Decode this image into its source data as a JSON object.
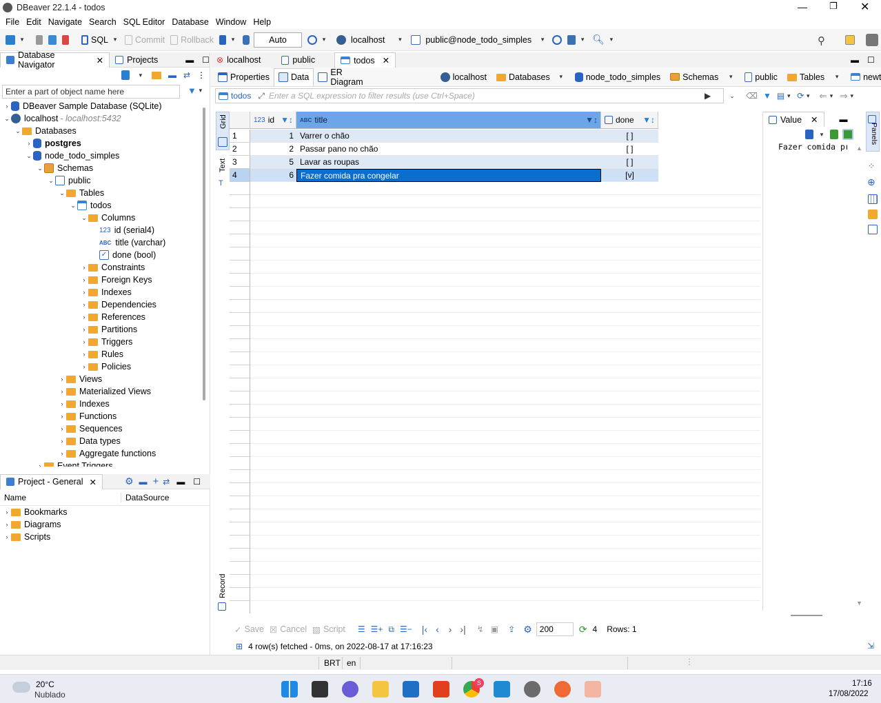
{
  "window": {
    "title": "DBeaver 22.1.4 - todos"
  },
  "menu": [
    "File",
    "Edit",
    "Navigate",
    "Search",
    "SQL Editor",
    "Database",
    "Window",
    "Help"
  ],
  "toolbar": {
    "sql": "SQL",
    "commit": "Commit",
    "rollback": "Rollback",
    "auto": "Auto",
    "connection": "localhost",
    "schema": "public@node_todo_simples"
  },
  "navigator": {
    "tabs": [
      "Database Navigator",
      "Projects"
    ],
    "filter_placeholder": "Enter a part of object name here",
    "tree": [
      {
        "label": "DBeaver Sample Database (SQLite)",
        "depth": 0,
        "caret": "›",
        "icon": "db-icon"
      },
      {
        "label": "localhost",
        "sub": " - localhost:5432",
        "depth": 0,
        "caret": "⌄",
        "icon": "server-icon"
      },
      {
        "label": "Databases",
        "depth": 1,
        "caret": "⌄",
        "icon": "folder-icon"
      },
      {
        "label": "postgres",
        "depth": 2,
        "caret": "›",
        "icon": "db-icon",
        "bold": true
      },
      {
        "label": "node_todo_simples",
        "depth": 2,
        "caret": "⌄",
        "icon": "db-icon"
      },
      {
        "label": "Schemas",
        "depth": 3,
        "caret": "⌄",
        "icon": "schema-folder-icon"
      },
      {
        "label": "public",
        "depth": 4,
        "caret": "⌄",
        "icon": "schema-icon"
      },
      {
        "label": "Tables",
        "depth": 5,
        "caret": "⌄",
        "icon": "tables-folder-icon"
      },
      {
        "label": "todos",
        "depth": 6,
        "caret": "⌄",
        "icon": "table-icon"
      },
      {
        "label": "Columns",
        "depth": 7,
        "caret": "⌄",
        "icon": "folder-icon"
      },
      {
        "label": "id (serial4)",
        "depth": 8,
        "caret": "",
        "icon": "number-column-icon"
      },
      {
        "label": "title (varchar)",
        "depth": 8,
        "caret": "",
        "icon": "text-column-icon"
      },
      {
        "label": "done (bool)",
        "depth": 8,
        "caret": "",
        "icon": "boolean-column-icon"
      },
      {
        "label": "Constraints",
        "depth": 7,
        "caret": "›",
        "icon": "folder-icon"
      },
      {
        "label": "Foreign Keys",
        "depth": 7,
        "caret": "›",
        "icon": "folder-icon"
      },
      {
        "label": "Indexes",
        "depth": 7,
        "caret": "›",
        "icon": "folder-icon"
      },
      {
        "label": "Dependencies",
        "depth": 7,
        "caret": "›",
        "icon": "folder-icon"
      },
      {
        "label": "References",
        "depth": 7,
        "caret": "›",
        "icon": "folder-icon"
      },
      {
        "label": "Partitions",
        "depth": 7,
        "caret": "›",
        "icon": "folder-icon"
      },
      {
        "label": "Triggers",
        "depth": 7,
        "caret": "›",
        "icon": "folder-icon"
      },
      {
        "label": "Rules",
        "depth": 7,
        "caret": "›",
        "icon": "folder-icon"
      },
      {
        "label": "Policies",
        "depth": 7,
        "caret": "›",
        "icon": "folder-icon"
      },
      {
        "label": "Views",
        "depth": 5,
        "caret": "›",
        "icon": "views-folder-icon"
      },
      {
        "label": "Materialized Views",
        "depth": 5,
        "caret": "›",
        "icon": "views-folder-icon"
      },
      {
        "label": "Indexes",
        "depth": 5,
        "caret": "›",
        "icon": "folder-icon"
      },
      {
        "label": "Functions",
        "depth": 5,
        "caret": "›",
        "icon": "folder-icon"
      },
      {
        "label": "Sequences",
        "depth": 5,
        "caret": "›",
        "icon": "folder-icon"
      },
      {
        "label": "Data types",
        "depth": 5,
        "caret": "›",
        "icon": "folder-icon"
      },
      {
        "label": "Aggregate functions",
        "depth": 5,
        "caret": "›",
        "icon": "folder-icon"
      },
      {
        "label": "Event Triggers",
        "depth": 3,
        "caret": "›",
        "icon": "folder-icon"
      }
    ]
  },
  "project": {
    "tab": "Project - General",
    "col_name": "Name",
    "col_ds": "DataSource",
    "items": [
      "Bookmarks",
      "Diagrams",
      "Scripts"
    ]
  },
  "editor": {
    "tabs": [
      "localhost",
      "public",
      "todos"
    ],
    "subtabs": [
      "Properties",
      "Data",
      "ER Diagram"
    ],
    "crumbs": [
      "localhost",
      "Databases",
      "node_todo_simples",
      "Schemas",
      "public",
      "Tables",
      "newtable"
    ],
    "filter_table": "todos",
    "filter_placeholder": "Enter a SQL expression to filter results (use Ctrl+Space)",
    "side_tabs": [
      "Grid",
      "Text",
      "Record"
    ]
  },
  "grid": {
    "columns": [
      {
        "label": "id",
        "type": "123"
      },
      {
        "label": "title",
        "type": "ABC"
      },
      {
        "label": "done",
        "type": "bool"
      }
    ],
    "rows": [
      {
        "n": "1",
        "id": "1",
        "title": "Varrer o chão",
        "done": "[ ]"
      },
      {
        "n": "2",
        "id": "2",
        "title": "Passar pano no chão",
        "done": "[ ]"
      },
      {
        "n": "3",
        "id": "5",
        "title": "Lavar as roupas",
        "done": "[ ]"
      },
      {
        "n": "4",
        "id": "6",
        "title": "Fazer comida pra congelar",
        "done": "[v]"
      }
    ]
  },
  "value_panel": {
    "tab": "Value",
    "content": "Fazer comida pra",
    "panels": "Panels"
  },
  "bottom": {
    "save": "Save",
    "cancel": "Cancel",
    "script": "Script",
    "fetch_size": "200",
    "count": "4",
    "rows": "Rows: 1",
    "status": "4 row(s) fetched - 0ms, on 2022-08-17 at 17:16:23"
  },
  "statusbar": {
    "tz": "BRT",
    "lang": "en"
  },
  "taskbar": {
    "temp": "20°C",
    "weather": "Nublado",
    "time": "17:16",
    "date": "17/08/2022",
    "badge": "S"
  }
}
